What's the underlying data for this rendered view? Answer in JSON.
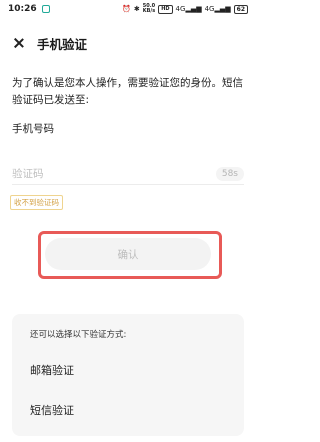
{
  "status_bar": {
    "time": "10:26",
    "speed_value": "50.0",
    "speed_unit": "KB/s",
    "hd_label": "HD",
    "signal1": "4G",
    "signal2": "4G",
    "battery": "62"
  },
  "header": {
    "title": "手机验证"
  },
  "description": "为了确认是您本人操作，需要验证您的身份。短信验证码已发送至:",
  "phone_label": "手机号码",
  "code_field": {
    "placeholder": "验证码",
    "value": "",
    "countdown": "58s"
  },
  "no_code_link": "收不到验证码",
  "confirm_button": "确认",
  "alternatives": {
    "title": "还可以选择以下验证方式:",
    "email": "邮箱验证",
    "sms": "短信验证"
  }
}
